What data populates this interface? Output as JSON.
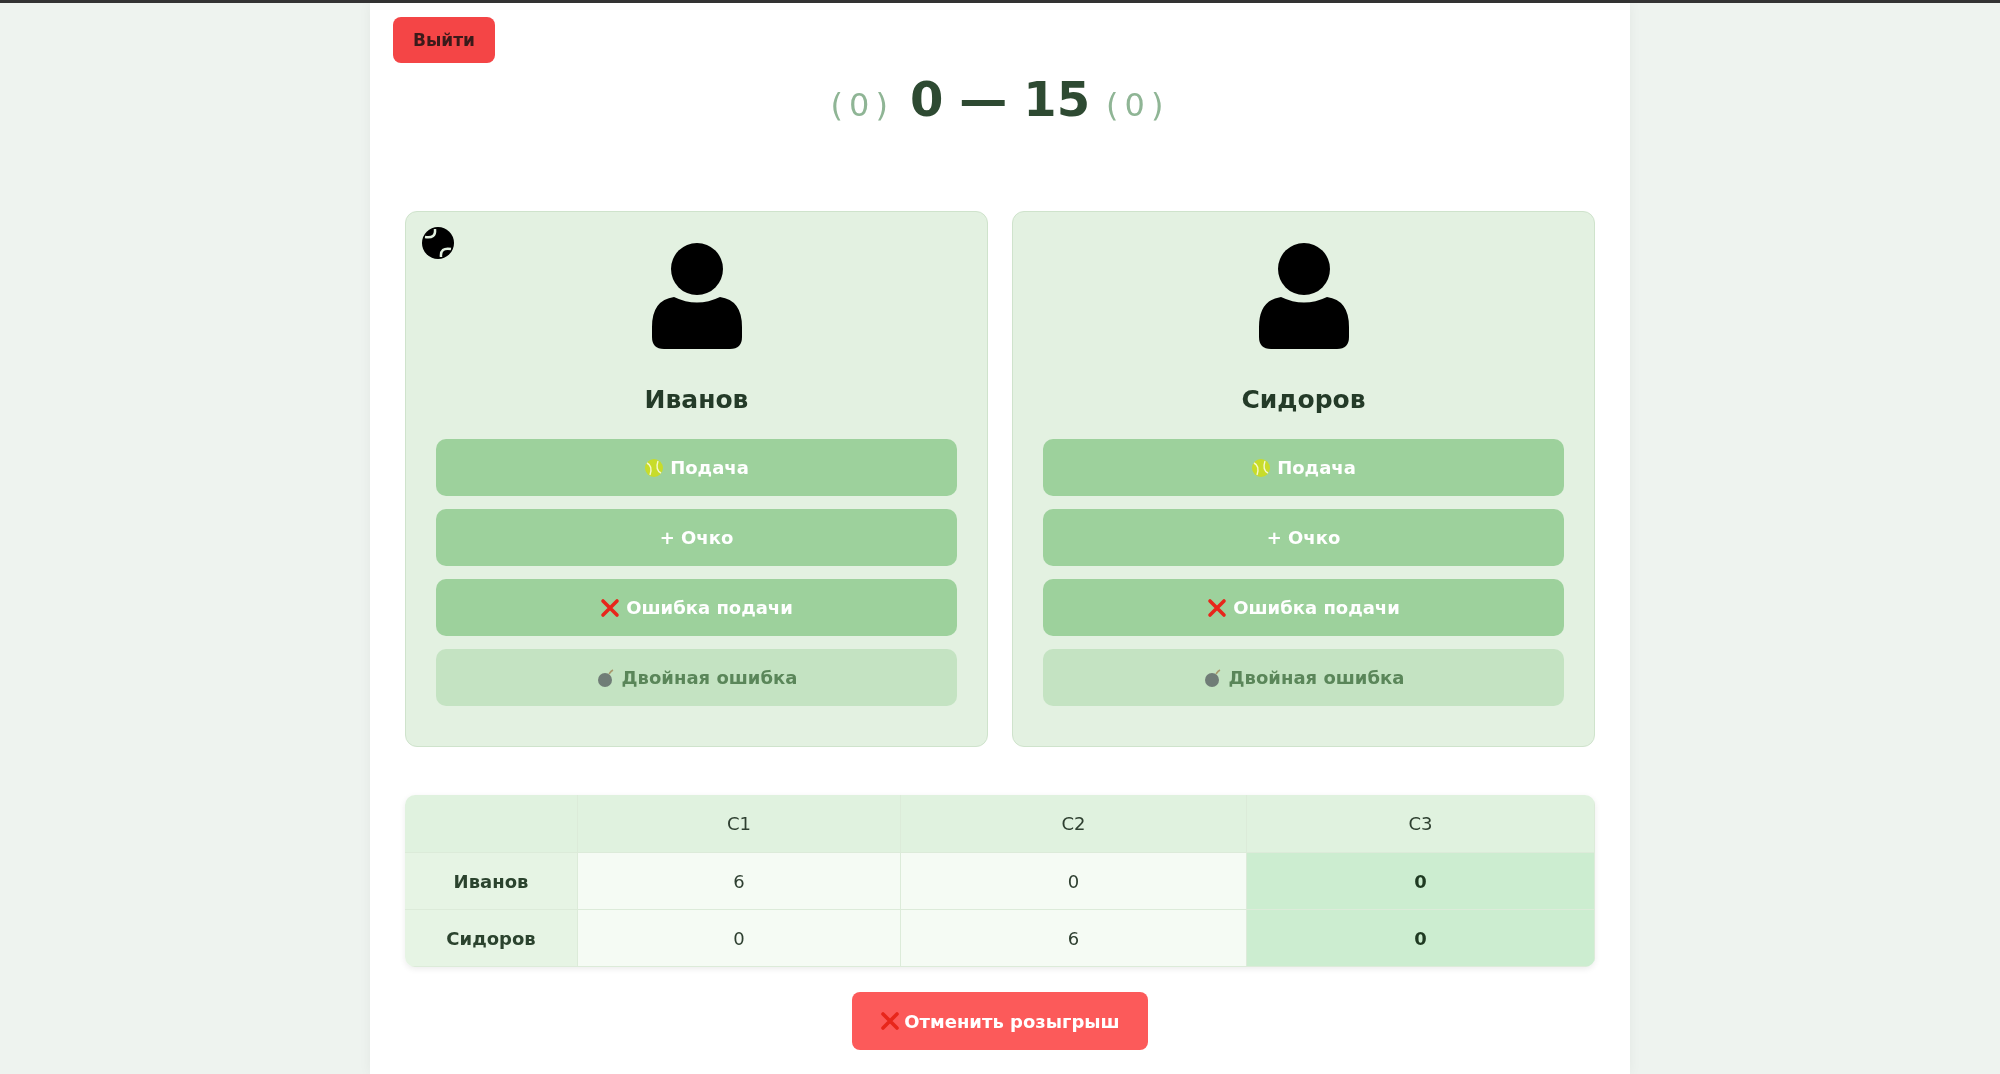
{
  "exit_button": {
    "label": "Выйти"
  },
  "score": {
    "left_sets": "(0)",
    "left_points": "0",
    "separator": "—",
    "right_points": "15",
    "right_sets": "(0)"
  },
  "players": [
    {
      "name": "Иванов",
      "serving": true,
      "buttons": [
        {
          "kind": "serve",
          "label": "Подача",
          "disabled": false
        },
        {
          "kind": "point",
          "label": "+ Очко",
          "disabled": false
        },
        {
          "kind": "fault",
          "label": "Ошибка подачи",
          "disabled": false
        },
        {
          "kind": "double_fault",
          "label": "Двойная ошибка",
          "disabled": true
        }
      ]
    },
    {
      "name": "Сидоров",
      "serving": false,
      "buttons": [
        {
          "kind": "serve",
          "label": "Подача",
          "disabled": false
        },
        {
          "kind": "point",
          "label": "+ Очко",
          "disabled": false
        },
        {
          "kind": "fault",
          "label": "Ошибка подачи",
          "disabled": false
        },
        {
          "kind": "double_fault",
          "label": "Двойная ошибка",
          "disabled": true
        }
      ]
    }
  ],
  "sets_table": {
    "columns": [
      {
        "label": "С1",
        "current": false
      },
      {
        "label": "С2",
        "current": false
      },
      {
        "label": "С3",
        "current": true
      }
    ],
    "rows": [
      {
        "player": "Иванов",
        "cells": [
          "6",
          "0",
          "0"
        ]
      },
      {
        "player": "Сидоров",
        "cells": [
          "0",
          "6",
          "0"
        ]
      }
    ]
  },
  "cancel_button": {
    "label": "Отменить розыгрыш"
  }
}
